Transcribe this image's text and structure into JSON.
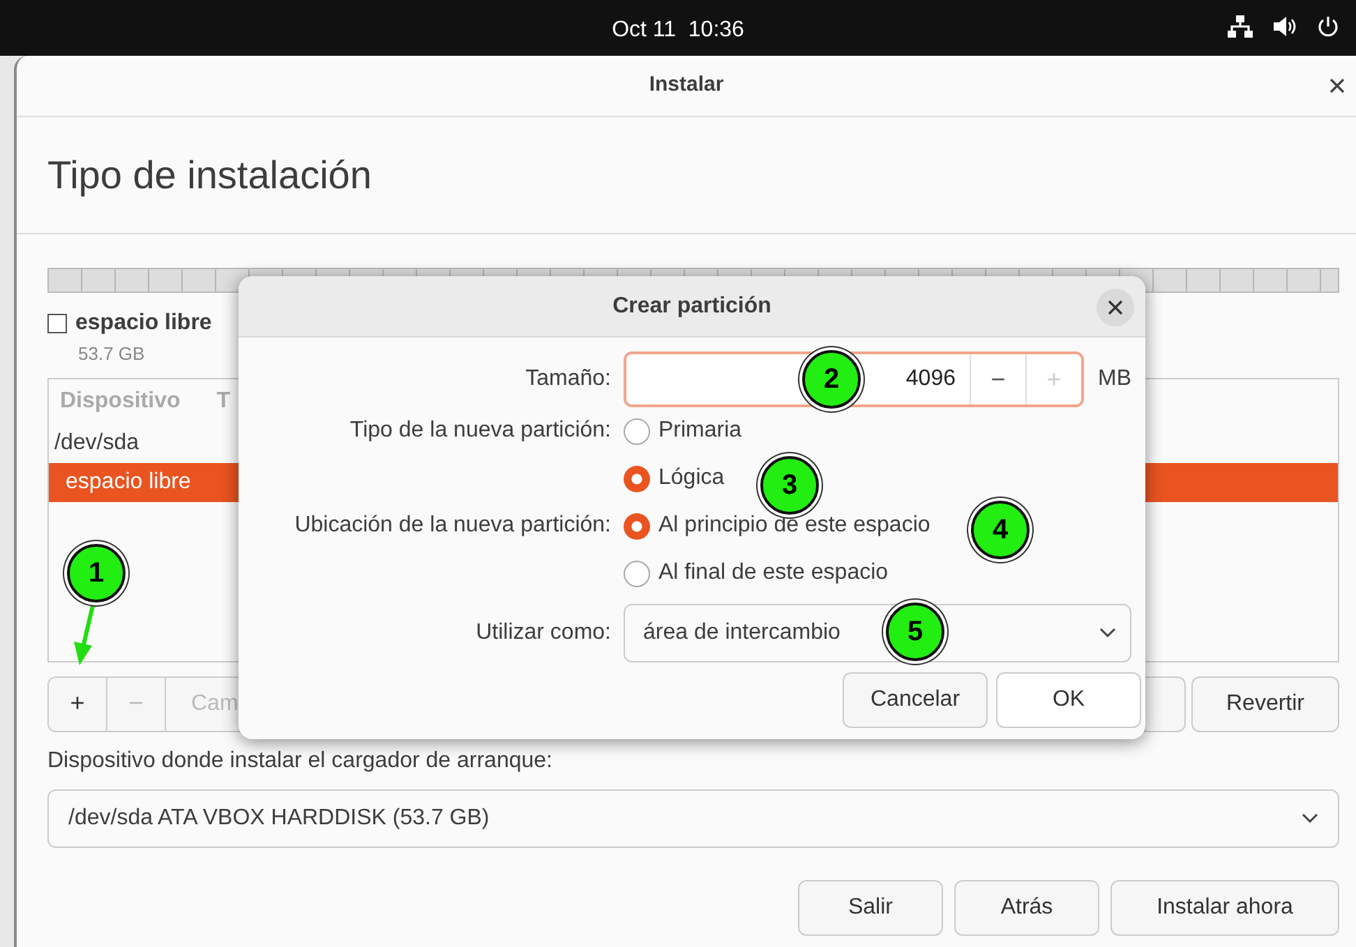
{
  "top_bar": {
    "clock": "Oct 11  10:36"
  },
  "window": {
    "title": "Instalar",
    "heading": "Tipo de instalación"
  },
  "free_space": {
    "label": "espacio libre",
    "size": "53.7 GB",
    "checked": false
  },
  "partition_table": {
    "columns": [
      "Dispositivo",
      "T"
    ],
    "rows": [
      {
        "device": "/dev/sda",
        "selected": false
      },
      {
        "device": "espacio libre",
        "selected": true
      }
    ]
  },
  "toolbar": [
    {
      "label": "+",
      "disabled": false
    },
    {
      "label": "−",
      "disabled": true
    },
    {
      "label": "Cam",
      "disabled": true
    }
  ],
  "revert_button": "Revertir",
  "bootloader": {
    "label": "Dispositivo donde instalar el cargador de arranque:",
    "value": "/dev/sda ATA VBOX HARDDISK (53.7 GB)"
  },
  "buttons": [
    "Salir",
    "Atrás",
    "Instalar ahora"
  ],
  "dialog": {
    "title": "Crear partición",
    "size": {
      "label": "Tamaño:",
      "value": "4096",
      "decrement": {
        "label": "−",
        "disabled": false
      },
      "increment": {
        "label": "+",
        "disabled": true
      },
      "unit": "MB"
    },
    "type": {
      "label": "Tipo de la nueva partición:",
      "options": [
        {
          "label": "Primaria",
          "selected": false
        },
        {
          "label": "Lógica",
          "selected": true
        }
      ]
    },
    "location": {
      "label": "Ubicación de la nueva partición:",
      "options": [
        {
          "label": "Al principio de este espacio",
          "selected": true
        },
        {
          "label": "Al final de este espacio",
          "selected": false
        }
      ]
    },
    "use_as": {
      "label": "Utilizar como:",
      "value": "área de intercambio"
    },
    "buttons": [
      "Cancelar",
      "OK"
    ]
  },
  "callouts": [
    {
      "label": "1"
    },
    {
      "label": "2"
    },
    {
      "label": "3"
    },
    {
      "label": "4"
    },
    {
      "label": "5"
    }
  ]
}
